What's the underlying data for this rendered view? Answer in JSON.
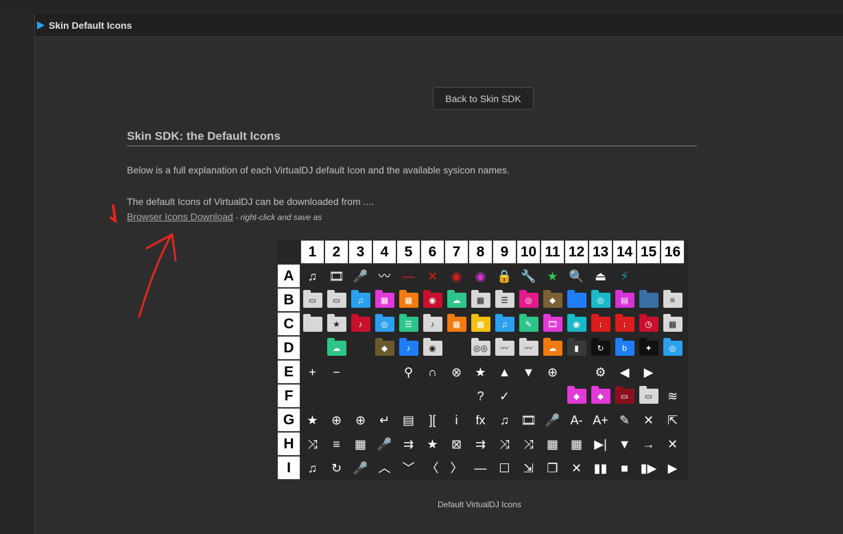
{
  "panel": {
    "title": "Skin Default Icons"
  },
  "back_button": "Back to Skin SDK",
  "heading": "Skin SDK: the Default Icons",
  "intro": "Below is a full explanation of each VirtualDJ default Icon and the available sysicon names.",
  "download_text": "The default Icons of VirtualDJ can be downloaded from ....",
  "download_link": "Browser Icons Download",
  "download_note": " - right-click and save as",
  "caption": "Default VirtualDJ Icons",
  "colors": {
    "accent": "#2aa0f0",
    "annotation": "#e0261f"
  },
  "grid": {
    "columns": [
      "1",
      "2",
      "3",
      "4",
      "5",
      "6",
      "7",
      "8",
      "9",
      "10",
      "11",
      "12",
      "13",
      "14",
      "15",
      "16"
    ],
    "rows": [
      {
        "label": "A",
        "icons": [
          "♫",
          "🎞",
          "🎤",
          "〰",
          "—",
          "✕",
          "◉",
          "◉",
          "🔒",
          "🔧",
          "★",
          "🔍",
          "⏏",
          "⚡",
          "",
          ""
        ]
      },
      {
        "label": "B",
        "icons": [
          "▭",
          "▭",
          "♫",
          "▦",
          "▦",
          "◉",
          "☁",
          "▦",
          "☰",
          "◎",
          "◆",
          "",
          "◎",
          "▤",
          "",
          "≡"
        ]
      },
      {
        "label": "C",
        "icons": [
          "",
          "★",
          "♪",
          "◎",
          "☰",
          "♪",
          "▦",
          "▦",
          "♫",
          "✎",
          "🎞",
          "◉",
          "↓",
          "↓",
          "◷",
          "▦"
        ]
      },
      {
        "label": "D",
        "icons": [
          "",
          "☁",
          "",
          "◆",
          "♪",
          "◉",
          "",
          "◎◎",
          "〰",
          "〰",
          "☁",
          "▮",
          "↻",
          "b",
          "✦",
          "◎"
        ]
      },
      {
        "label": "E",
        "icons": [
          "+",
          "−",
          "",
          "",
          "⚲",
          "∩",
          "⊗",
          "★",
          "▲",
          "▼",
          "⊕",
          "",
          "⚙",
          "◀",
          "▶",
          ""
        ]
      },
      {
        "label": "F",
        "icons": [
          "",
          "",
          "",
          "",
          "",
          "",
          "",
          "?",
          "✓",
          "",
          "",
          "◆",
          "◆",
          "▭",
          "▭",
          "≋"
        ]
      },
      {
        "label": "G",
        "icons": [
          "★",
          "⊕",
          "⊕",
          "↵",
          "▤",
          "][",
          "i",
          "fx",
          "♫",
          "🎞",
          "🎤",
          "A-",
          "A+",
          "✎",
          "✕",
          "⇱"
        ]
      },
      {
        "label": "H",
        "icons": [
          "⤨",
          "≡",
          "▦",
          "🎤",
          "⇉",
          "★",
          "⊠",
          "⇉",
          "⤨",
          "⤨",
          "▦",
          "▦",
          "▶|",
          "▼",
          "→",
          "✕"
        ]
      },
      {
        "label": "I",
        "icons": [
          "♫",
          "↻",
          "🎤",
          "︿",
          "﹀",
          "〈",
          "〉",
          "—",
          "☐",
          "⇲",
          "❐",
          "✕",
          "▮▮",
          "■",
          "▮▶",
          "▶"
        ]
      }
    ],
    "folder_colors": {
      "B": [
        "#d8d8d8",
        "#d8d8d8",
        "#2ba0ee",
        "#e23ad6",
        "#f27a10",
        "#c8102e",
        "#2ec48a",
        "#d8d8d8",
        "#d8d8d8",
        "#e4198a",
        "#7a6236",
        "#1f7ef5",
        "#19b9c9",
        "#d633d6",
        "#3a6ea5",
        "#d8d8d8"
      ],
      "C": [
        "#d8d8d8",
        "#d8d8d8",
        "#c8102e",
        "#2ba0ee",
        "#2ec48a",
        "#d8d8d8",
        "#f27a10",
        "#f2c010",
        "#2ba0ee",
        "#2ec48a",
        "#e23ad6",
        "#19b9c9",
        "#d91c1c",
        "#d91c1c",
        "#c8102e",
        "#d8d8d8"
      ],
      "D": [
        "",
        "#2ec48a",
        "",
        "#6b5a30",
        "#1f7ef5",
        "#d8d8d8",
        "",
        "#d8d8d8",
        "#d8d8d8",
        "#d8d8d8",
        "#f27a10",
        "#3a3a3a",
        "#111111",
        "#1f7ef5",
        "#111111",
        "#2ba0ee"
      ],
      "F": [
        "",
        "",
        "",
        "",
        "",
        "",
        "",
        "",
        "",
        "",
        "",
        "#e23ad6",
        "#e23ad6",
        "#8a1020",
        "#d8d8d8",
        ""
      ]
    }
  }
}
